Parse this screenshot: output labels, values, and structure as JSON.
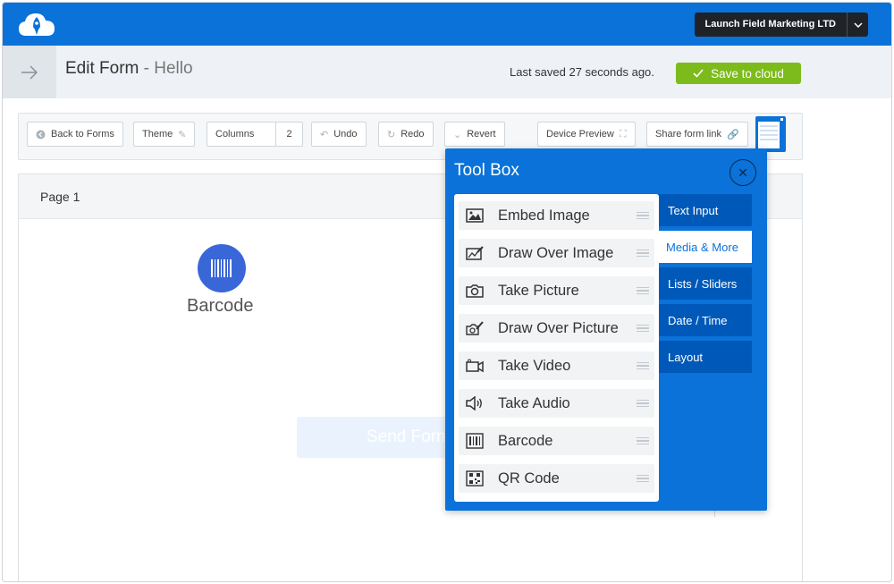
{
  "account": {
    "name": "Launch Field Marketing LTD"
  },
  "header": {
    "title": "Edit Form",
    "separator": " - ",
    "form_name": "Hello",
    "last_saved": "Last saved 27 seconds ago.",
    "save_label": "Save to cloud"
  },
  "toolbar": {
    "back": "Back to Forms",
    "theme": "Theme",
    "columns": "Columns",
    "columns_value": "2",
    "undo": "Undo",
    "redo": "Redo",
    "revert": "Revert",
    "device_preview": "Device Preview",
    "share": "Share form link"
  },
  "page": {
    "label": "Page 1",
    "field_label": "Barcode",
    "send_label": "Send Form"
  },
  "toolbox": {
    "title": "Tool Box",
    "items": [
      {
        "label": "Embed Image",
        "icon": "image-icon"
      },
      {
        "label": "Draw Over Image",
        "icon": "draw-image-icon"
      },
      {
        "label": "Take Picture",
        "icon": "camera-icon"
      },
      {
        "label": "Draw Over Picture",
        "icon": "draw-picture-icon"
      },
      {
        "label": "Take Video",
        "icon": "video-icon"
      },
      {
        "label": "Take Audio",
        "icon": "speaker-icon"
      },
      {
        "label": "Barcode",
        "icon": "barcode-icon"
      },
      {
        "label": "QR Code",
        "icon": "qrcode-icon"
      }
    ],
    "tabs": [
      {
        "label": "Text Input",
        "active": false
      },
      {
        "label": "Media & More",
        "active": true
      },
      {
        "label": "Lists / Sliders",
        "active": false
      },
      {
        "label": "Date / Time",
        "active": false
      },
      {
        "label": "Layout",
        "active": false
      }
    ]
  },
  "colors": {
    "brand_blue": "#0a72d9",
    "save_green": "#7dbb1c",
    "field_blue": "#3a67d8"
  }
}
